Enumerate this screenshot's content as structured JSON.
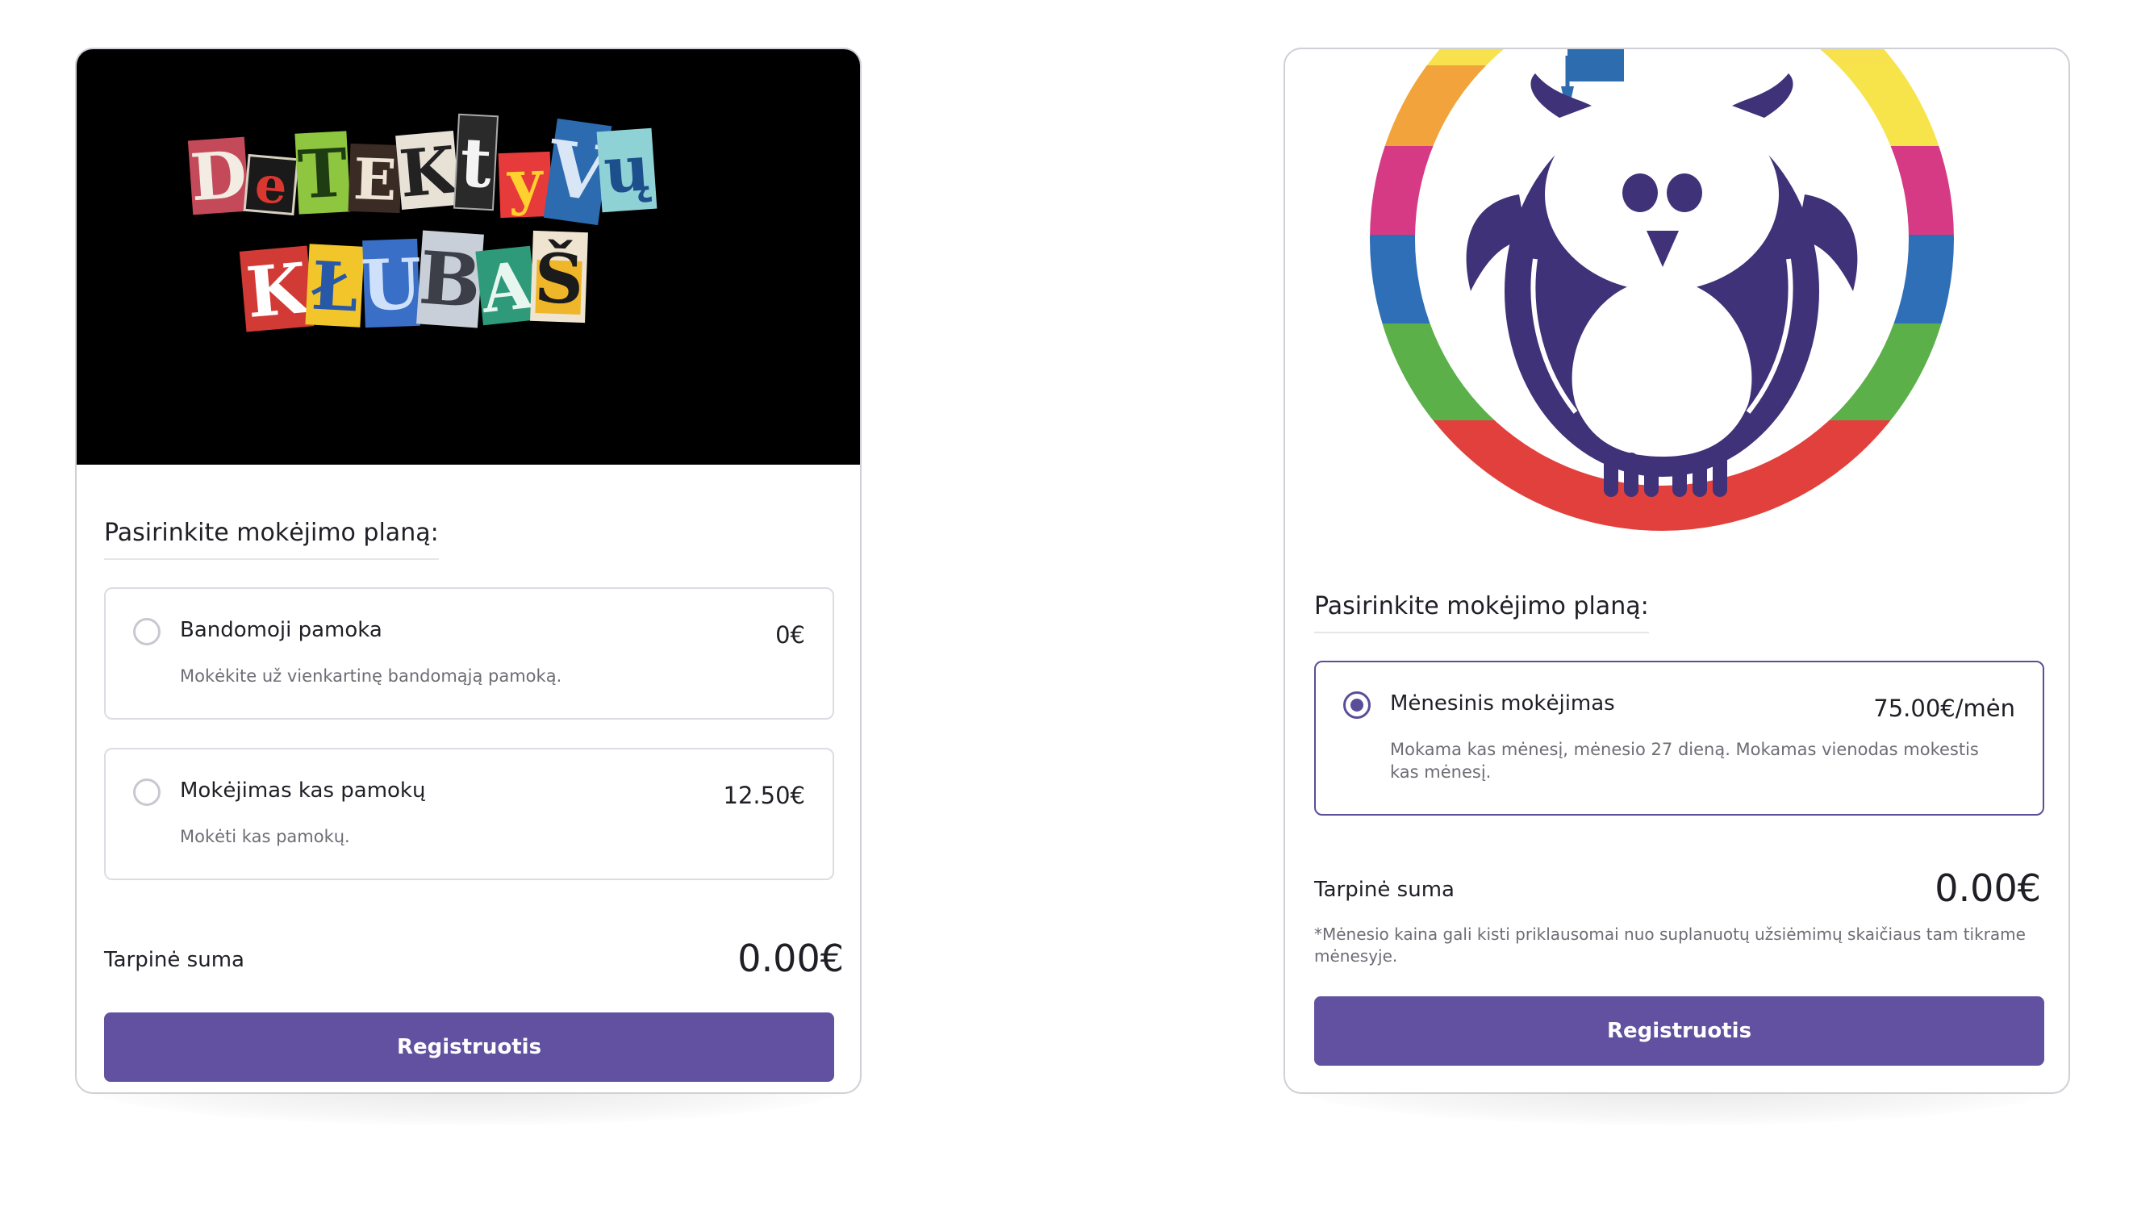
{
  "colors": {
    "accent": "#6250a0",
    "selected_border": "#5b4e99",
    "owl": "#3f3279"
  },
  "left_card": {
    "logo": {
      "line1_letters": [
        "D",
        "e",
        "T",
        "E",
        "K",
        "t",
        "y",
        "V",
        "ų"
      ],
      "line2_letters": [
        "K",
        "Ł",
        "U",
        "B",
        "A",
        "Š"
      ]
    },
    "section_title": "Pasirinkite mokėjimo planą:",
    "plans": [
      {
        "name": "Bandomoji pamoka",
        "price": "0€",
        "description": "Mokėkite už vienkartinę bandomąją pamoką."
      },
      {
        "name": "Mokėjimas kas pamokų",
        "price": "12.50€",
        "description": "Mokėti kas pamokų."
      }
    ],
    "subtotal_label": "Tarpinė suma",
    "subtotal_value": "0.00€",
    "register_label": "Registruotis"
  },
  "right_card": {
    "logo_icon": "owl-graduate-logo",
    "section_title": "Pasirinkite mokėjimo planą:",
    "plans": [
      {
        "name": "Mėnesinis mokėjimas",
        "price": "75.00€/mėn",
        "description": "Mokama kas mėnesį, mėnesio 27 dieną. Mokamas vienodas mokestis kas mėnesį.",
        "selected": true
      }
    ],
    "subtotal_label": "Tarpinė suma",
    "subtotal_value": "0.00€",
    "note": "*Mėnesio kaina gali kisti priklausomai nuo suplanuotų užsiėmimų skaičiaus tam tikrame mėnesyje.",
    "register_label": "Registruotis"
  }
}
